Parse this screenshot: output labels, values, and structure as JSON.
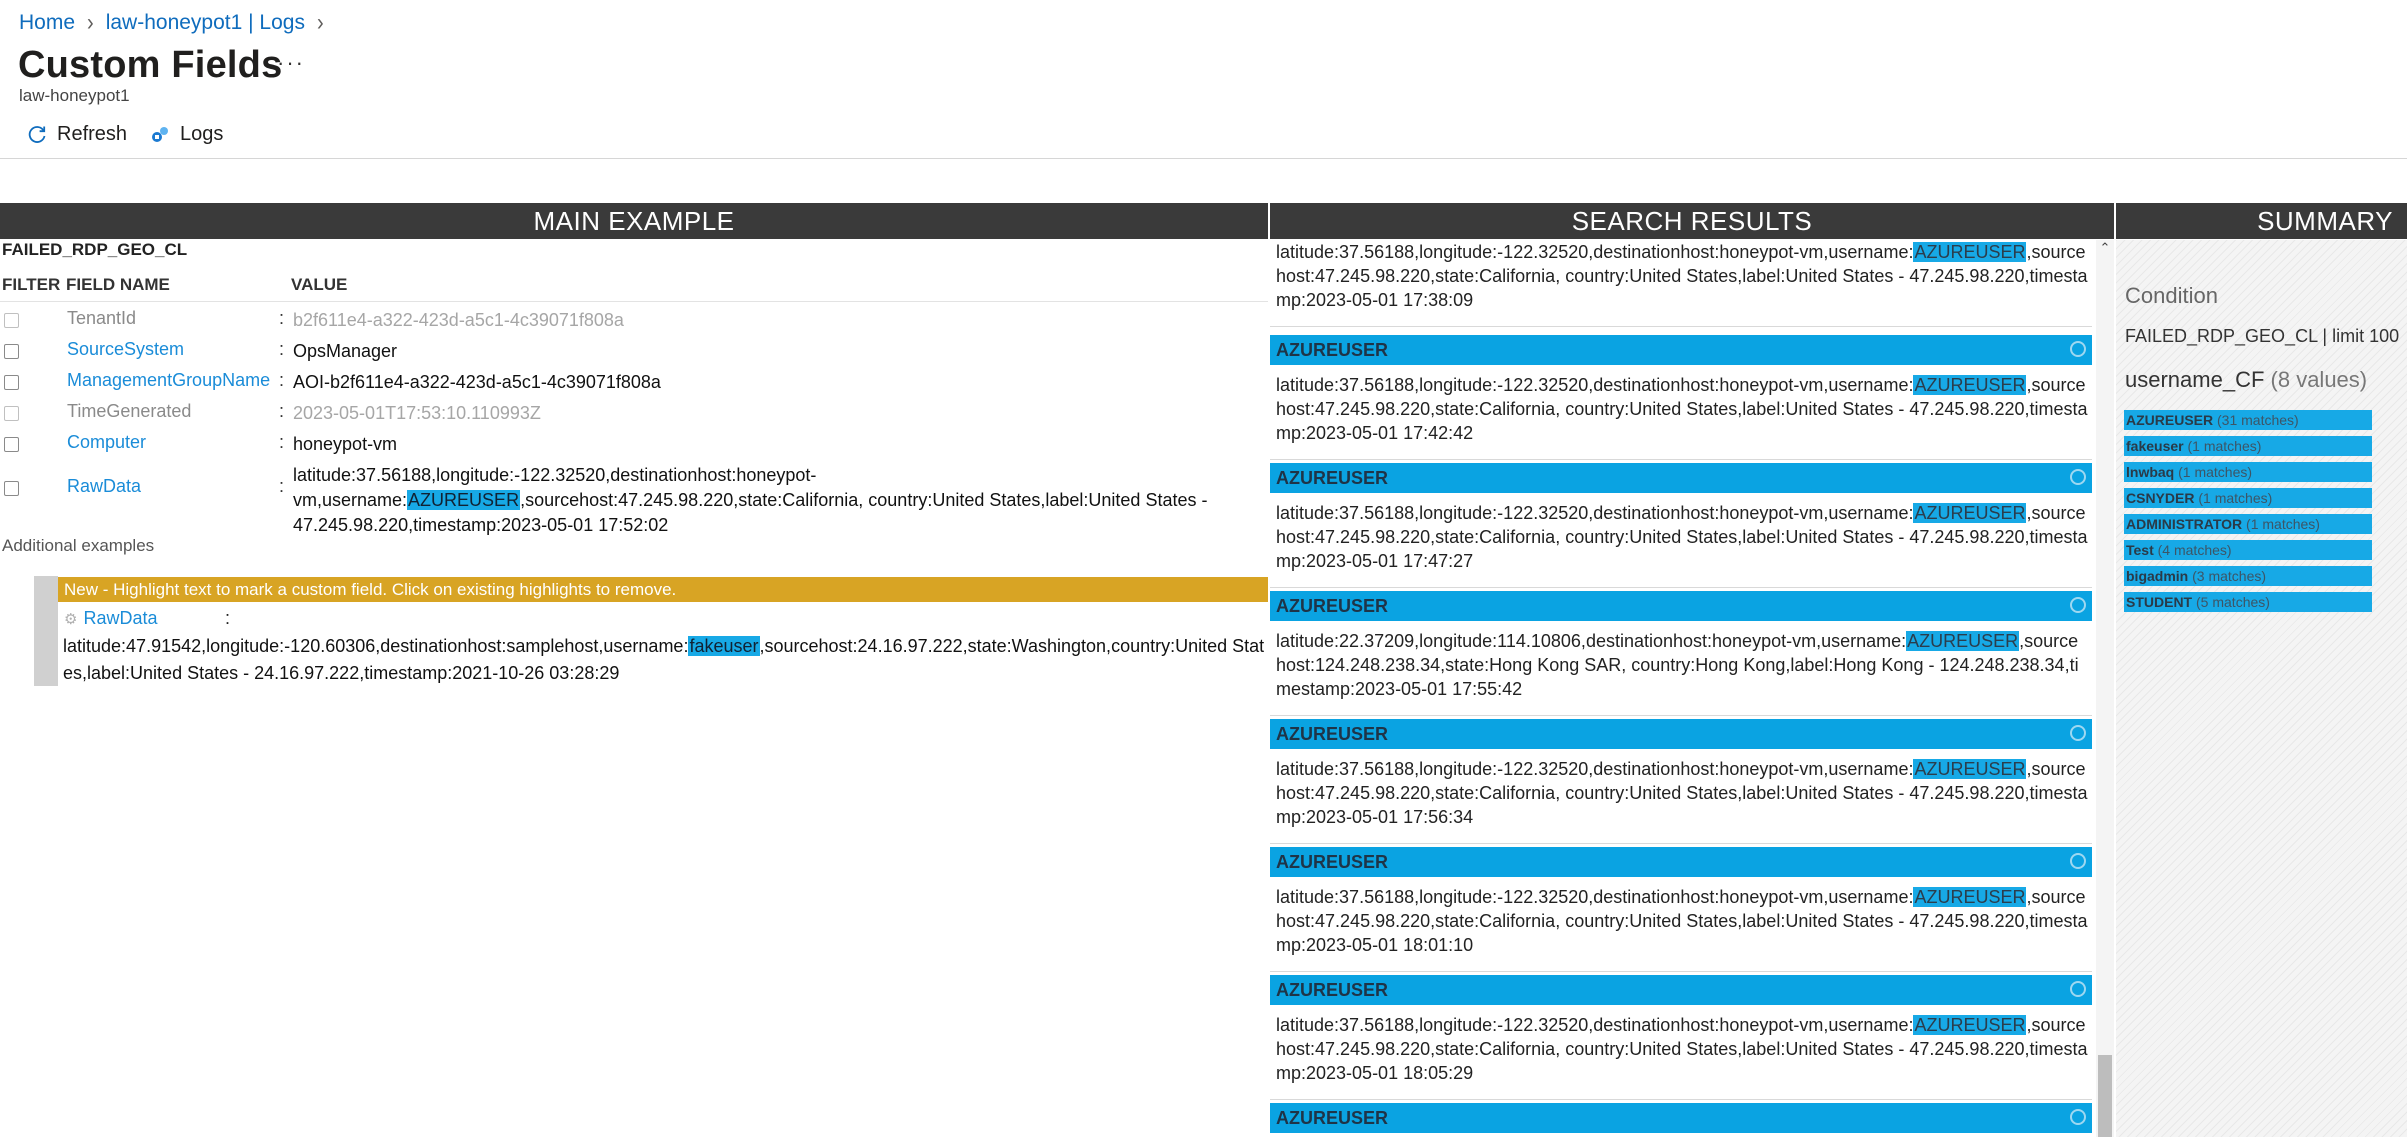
{
  "breadcrumb": {
    "home": "Home",
    "parent": "law-honeypot1 | Logs"
  },
  "page": {
    "title": "Custom Fields",
    "subtitle": "law-honeypot1",
    "more": "···"
  },
  "toolbar": {
    "refresh": "Refresh",
    "logs": "Logs"
  },
  "panels": {
    "main": "MAIN EXAMPLE",
    "search": "SEARCH RESULTS",
    "summary": "SUMMARY"
  },
  "main_example": {
    "table_name": "FAILED_RDP_GEO_CL",
    "headers": {
      "filter": "FILTER",
      "field_name": "FIELD NAME",
      "value": "VALUE"
    },
    "fields": [
      {
        "name": "TenantId",
        "value": "b2f611e4-a322-423d-a5c1-4c39071f808a",
        "dim": true
      },
      {
        "name": "SourceSystem",
        "value": "OpsManager",
        "dim": false
      },
      {
        "name": "ManagementGroupName",
        "value": "AOI-b2f611e4-a322-423d-a5c1-4c39071f808a",
        "dim": false
      },
      {
        "name": "TimeGenerated",
        "value": "2023-05-01T17:53:10.110993Z",
        "dim": true
      },
      {
        "name": "Computer",
        "value": "honeypot-vm",
        "dim": false
      }
    ],
    "rawdata": {
      "name": "RawData",
      "before": "latitude:37.56188,longitude:-122.32520,destinationhost:honeypot-vm,username:",
      "highlight": "AZUREUSER",
      "after": ",sourcehost:47.245.98.220,state:California, country:United States,label:United States - 47.245.98.220,timestamp:2023-05-01 17:52:02"
    }
  },
  "additional": {
    "label": "Additional examples",
    "banner": "New - Highlight text to mark a custom field. Click on existing highlights to remove.",
    "field": "RawData",
    "colon": ":",
    "before": "latitude:47.91542,longitude:-120.60306,destinationhost:samplehost,username:",
    "highlight": "fakeuser",
    "after": ",sourcehost:24.16.97.222,state:Washington,country:United States,label:United States - 24.16.97.222,timestamp:2021-10-26 03:28:29"
  },
  "search_results": [
    {
      "title": "",
      "before": "latitude:37.56188,longitude:-122.32520,destinationhost:honeypot-vm,username:",
      "highlight": "AZUREUSER",
      "after": ",sourcehost:47.245.98.220,state:California, country:United States,label:United States - 47.245.98.220,timestamp:2023-05-01 17:38:09"
    },
    {
      "title": "AZUREUSER",
      "before": "latitude:37.56188,longitude:-122.32520,destinationhost:honeypot-vm,username:",
      "highlight": "AZUREUSER",
      "after": ",sourcehost:47.245.98.220,state:California, country:United States,label:United States - 47.245.98.220,timestamp:2023-05-01 17:42:42"
    },
    {
      "title": "AZUREUSER",
      "before": "latitude:37.56188,longitude:-122.32520,destinationhost:honeypot-vm,username:",
      "highlight": "AZUREUSER",
      "after": ",sourcehost:47.245.98.220,state:California, country:United States,label:United States - 47.245.98.220,timestamp:2023-05-01 17:47:27"
    },
    {
      "title": "AZUREUSER",
      "before": "latitude:22.37209,longitude:114.10806,destinationhost:honeypot-vm,username:",
      "highlight": "AZUREUSER",
      "after": ",sourcehost:124.248.238.34,state:Hong Kong SAR, country:Hong Kong,label:Hong Kong - 124.248.238.34,timestamp:2023-05-01 17:55:42"
    },
    {
      "title": "AZUREUSER",
      "before": "latitude:37.56188,longitude:-122.32520,destinationhost:honeypot-vm,username:",
      "highlight": "AZUREUSER",
      "after": ",sourcehost:47.245.98.220,state:California, country:United States,label:United States - 47.245.98.220,timestamp:2023-05-01 17:56:34"
    },
    {
      "title": "AZUREUSER",
      "before": "latitude:37.56188,longitude:-122.32520,destinationhost:honeypot-vm,username:",
      "highlight": "AZUREUSER",
      "after": ",sourcehost:47.245.98.220,state:California, country:United States,label:United States - 47.245.98.220,timestamp:2023-05-01 18:01:10"
    },
    {
      "title": "AZUREUSER",
      "before": "latitude:37.56188,longitude:-122.32520,destinationhost:honeypot-vm,username:",
      "highlight": "AZUREUSER",
      "after": ",sourcehost:47.245.98.220,state:California, country:United States,label:United States - 47.245.98.220,timestamp:2023-05-01 18:05:29"
    },
    {
      "title": "AZUREUSER",
      "before": "",
      "highlight": "",
      "after": ""
    }
  ],
  "summary": {
    "condition_heading": "Condition",
    "condition": "FAILED_RDP_GEO_CL | limit 100",
    "field": "username_CF",
    "field_count": "(8 values)",
    "values": [
      {
        "value": "AZUREUSER",
        "matches": "(31 matches)"
      },
      {
        "value": "fakeuser",
        "matches": "(1 matches)"
      },
      {
        "value": "lnwbaq",
        "matches": "(1 matches)"
      },
      {
        "value": "CSNYDER",
        "matches": "(1 matches)"
      },
      {
        "value": "ADMINISTRATOR",
        "matches": "(1 matches)"
      },
      {
        "value": "Test",
        "matches": "(4 matches)"
      },
      {
        "value": "bigadmin",
        "matches": "(3 matches)"
      },
      {
        "value": "STUDENT",
        "matches": "(5 matches)"
      }
    ]
  },
  "colors": {
    "accent": "#0f6cbd",
    "header_bar": "#3a3a3a",
    "highlight": "#17a9e6",
    "result_header": "#0aa3e2",
    "banner": "#d8a424"
  }
}
